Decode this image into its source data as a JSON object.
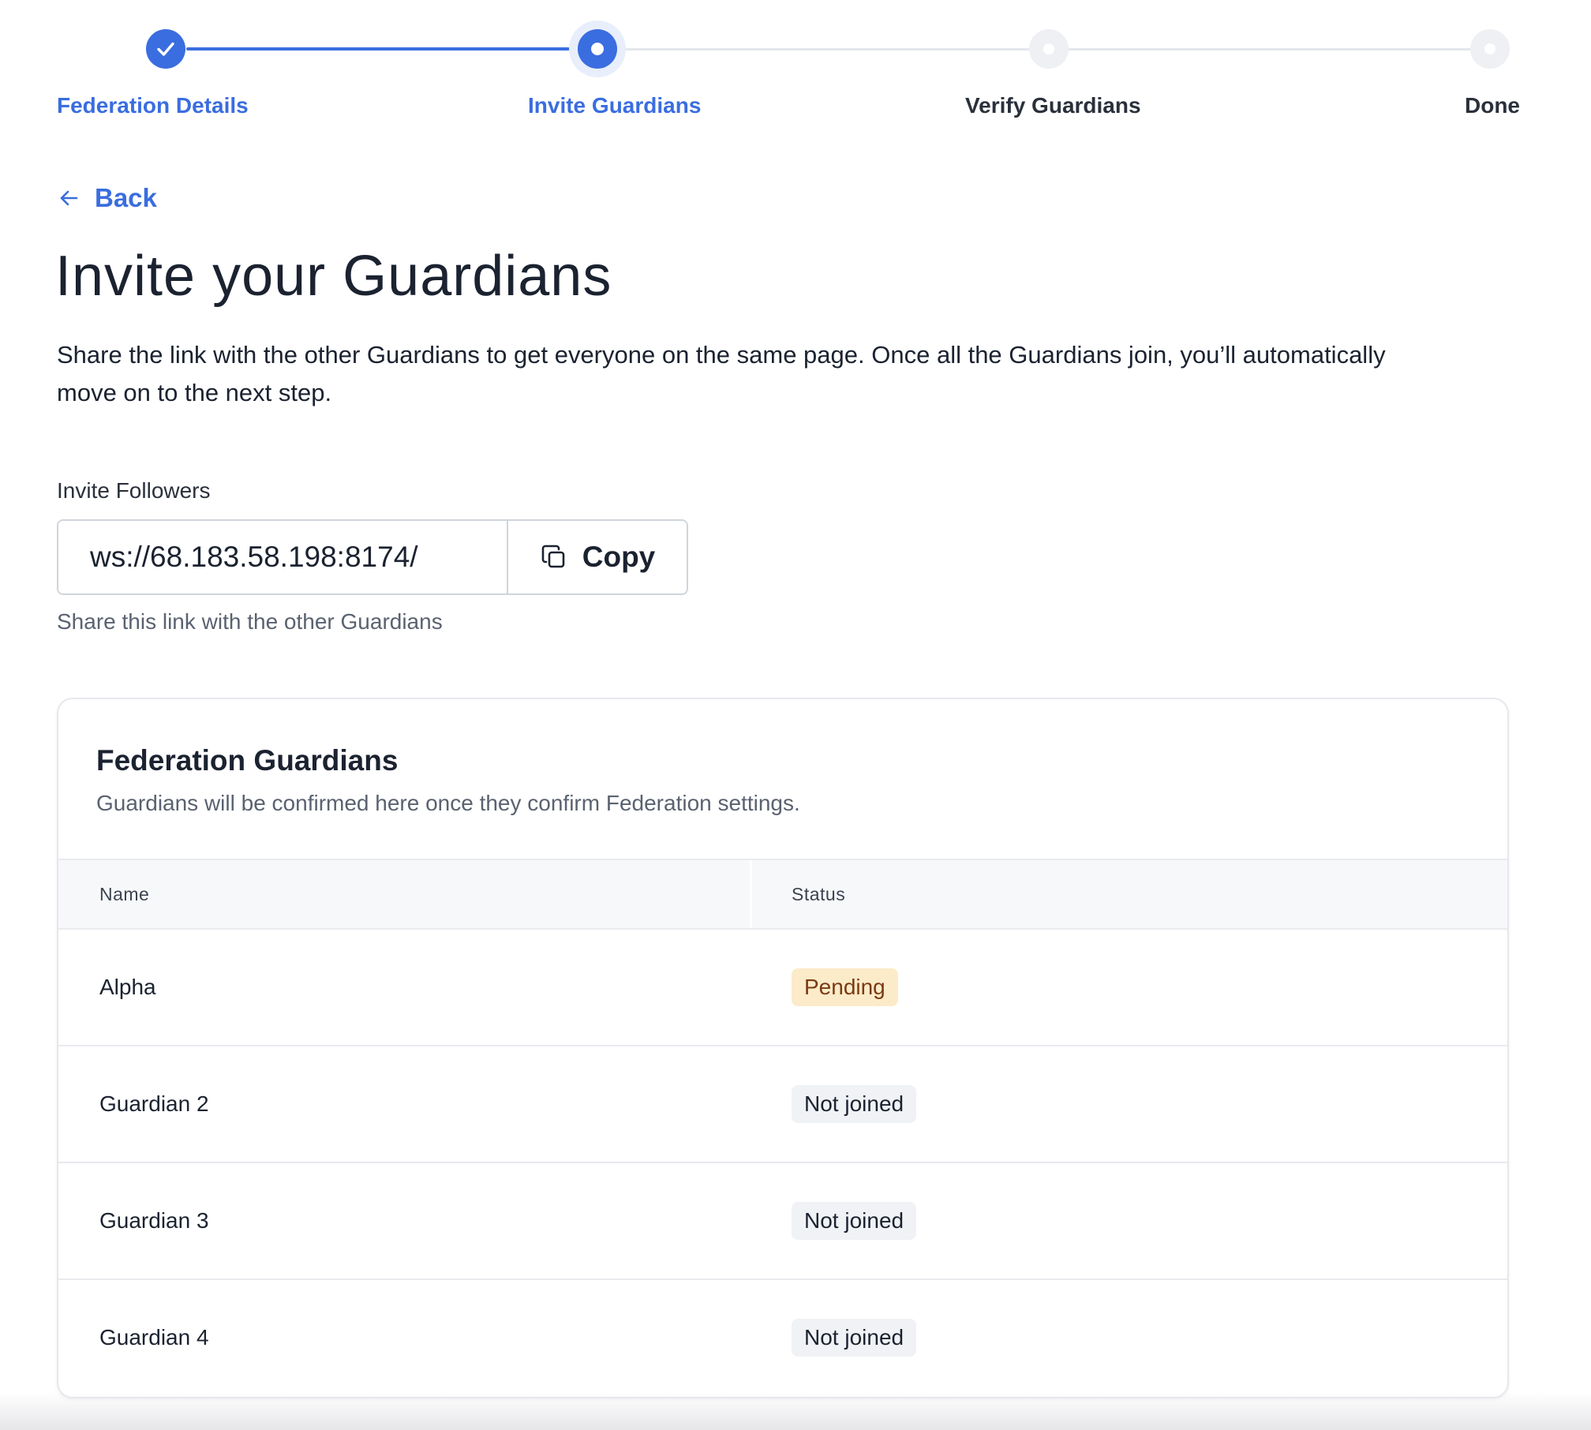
{
  "stepper": {
    "steps": [
      {
        "label": "Federation Details",
        "state": "complete"
      },
      {
        "label": "Invite Guardians",
        "state": "current"
      },
      {
        "label": "Verify Guardians",
        "state": "upcoming"
      },
      {
        "label": "Done",
        "state": "upcoming"
      }
    ]
  },
  "back": {
    "label": "Back",
    "icon": "arrow-left-icon"
  },
  "page": {
    "title": "Invite your Guardians",
    "intro": "Share the link with the other Guardians to get everyone on the same page. Once all the Guardians join, you’ll automatically move on to the next step."
  },
  "invite": {
    "label": "Invite Followers",
    "value": "ws://68.183.58.198:8174/",
    "copy_label": "Copy",
    "copy_icon": "copy-icon",
    "helper": "Share this link with the other Guardians"
  },
  "guardians": {
    "title": "Federation Guardians",
    "subtitle": "Guardians will be confirmed here once they confirm Federation settings.",
    "columns": {
      "name": "Name",
      "status": "Status"
    },
    "rows": [
      {
        "name": "Alpha",
        "status": "Pending"
      },
      {
        "name": "Guardian 2",
        "status": "Not joined"
      },
      {
        "name": "Guardian 3",
        "status": "Not joined"
      },
      {
        "name": "Guardian 4",
        "status": "Not joined"
      }
    ]
  },
  "colors": {
    "accent": "#3a6ddf",
    "pending_bg": "#fcebc9",
    "pending_text": "#7a3a12",
    "not_joined_bg": "#f0f2f5"
  }
}
